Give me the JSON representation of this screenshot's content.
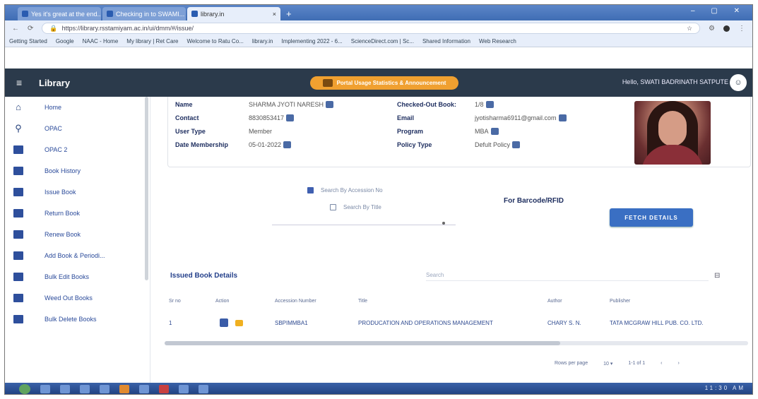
{
  "browser": {
    "tabs": [
      {
        "label": "Yes it's great at the end..."
      },
      {
        "label": "Checking in to SWAMI..."
      },
      {
        "label": "library.in"
      }
    ],
    "url": "https://library.rsstamiyam.ac.in/ui/dmm/#/issue/",
    "bookmarks": [
      "Getting Started",
      "Google",
      "NAAC - Home",
      "My library | Ret Care",
      "Welcome to Ratu Co...",
      "library.in",
      "Implementing 2022 - 6...",
      "ScienceDirect.com | Sc...",
      "Shared Information",
      "Web Research"
    ]
  },
  "app": {
    "title": "Library",
    "announcement": "Portal Usage Statistics & Announcement",
    "greeting": "Hello, SWATI BADRINATH SATPUTE",
    "profile_icon": "account-icon"
  },
  "sidebar": {
    "items": [
      {
        "label": "Home",
        "icon": "home-icon"
      },
      {
        "label": "OPAC",
        "icon": "search-icon"
      },
      {
        "label": "OPAC 2",
        "icon": "book-icon"
      },
      {
        "label": "Book History",
        "icon": "book-icon"
      },
      {
        "label": "Issue Book",
        "icon": "book-icon"
      },
      {
        "label": "Return Book",
        "icon": "book-icon"
      },
      {
        "label": "Renew Book",
        "icon": "book-icon"
      },
      {
        "label": "Add Book & Periodi...",
        "icon": "book-icon"
      },
      {
        "label": "Bulk Edit Books",
        "icon": "book-icon"
      },
      {
        "label": "Weed Out Books",
        "icon": "book-icon"
      },
      {
        "label": "Bulk Delete Books",
        "icon": "book-icon"
      }
    ]
  },
  "member": {
    "name_label": "Name",
    "name": "SHARMA JYOTI NARESH",
    "contact_label": "Contact",
    "contact": "8830853417",
    "user_type_label": "User Type",
    "user_type": "Member",
    "date_membership_label": "Date Membership",
    "date_membership": "05-01-2022",
    "checked_out_label": "Checked-Out Book:",
    "checked_out": "1/8",
    "email_label": "Email",
    "email": "jyotisharma6911@gmail.com",
    "program_label": "Program",
    "program": "MBA",
    "policy_label": "Policy Type",
    "policy": "Defult Policy"
  },
  "search_options": {
    "accession": "Search By Accession No",
    "title": "Search By Title",
    "barcode_label": "For Barcode/RFID",
    "fetch_button": "FETCH DETAILS"
  },
  "issued": {
    "title": "Issued Book Details",
    "search_placeholder": "Search",
    "columns": [
      "Sr no",
      "Action",
      "Accession Number",
      "Title",
      "Author",
      "Publisher"
    ],
    "rows": [
      {
        "sr": "1",
        "accession": "SBPIMMBA1",
        "title": "PRODUCATION AND OPERATIONS MANAGEMENT",
        "author": "CHARY S. N.",
        "publisher": "TATA MCGRAW HILL PUB. CO. LTD."
      }
    ],
    "rows_per_page_label": "Rows per page",
    "rows_per_page": "10",
    "range": "1-1 of 1"
  },
  "taskbar": {
    "clock": "11:30 AM"
  }
}
